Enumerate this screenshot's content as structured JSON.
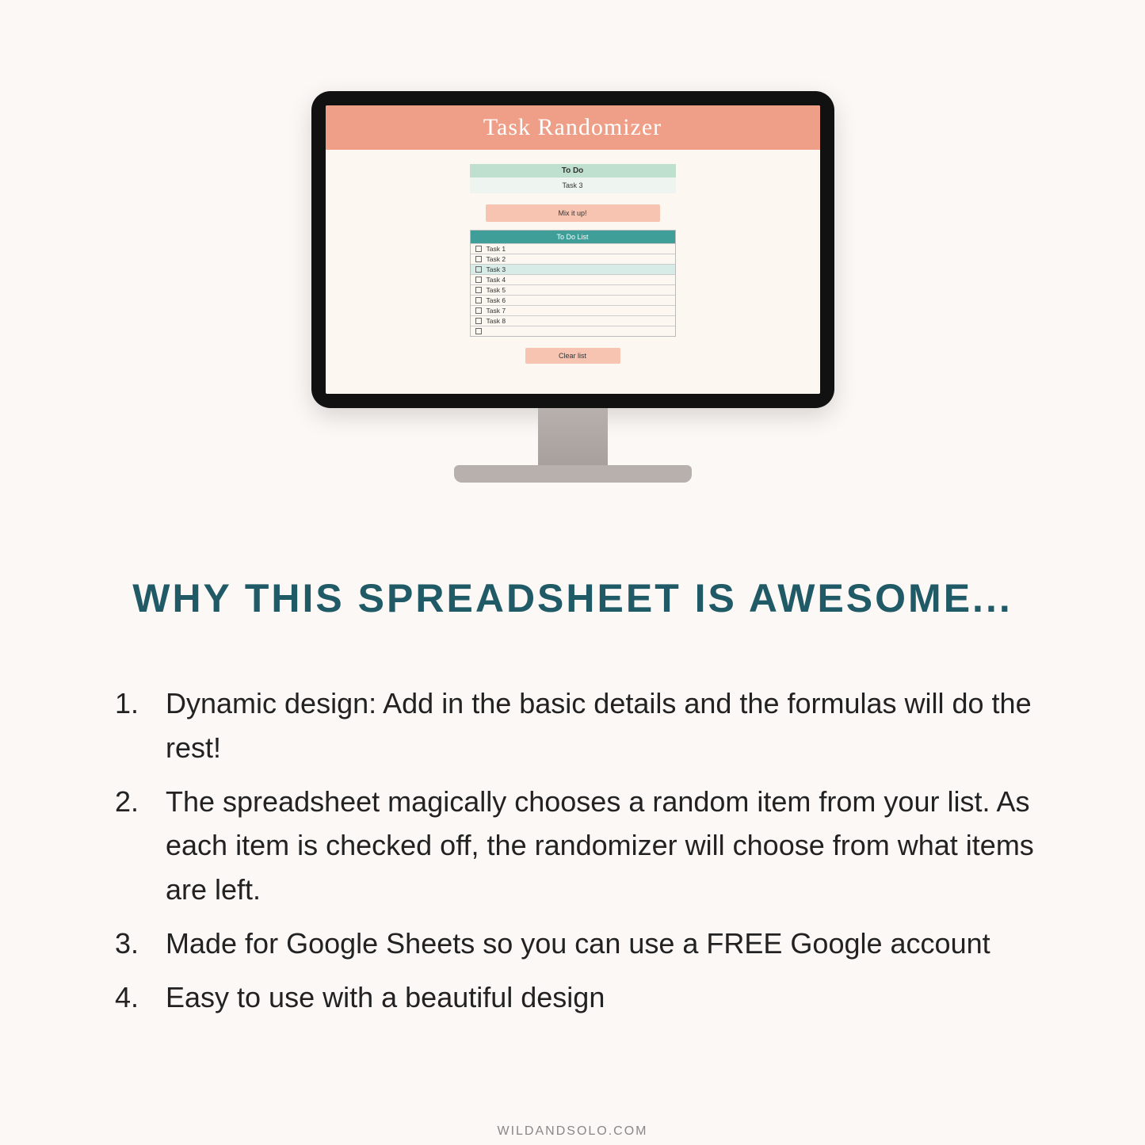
{
  "app": {
    "banner_title": "Task Randomizer",
    "todo_header": "To Do",
    "current_task": "Task 3",
    "mix_button": "Mix it up!",
    "list_header": "To Do List",
    "tasks": [
      "Task 1",
      "Task 2",
      "Task 3",
      "Task 4",
      "Task 5",
      "Task 6",
      "Task 7",
      "Task 8",
      ""
    ],
    "highlight_index": 2,
    "clear_button": "Clear list"
  },
  "headline": "WHY THIS SPREADSHEET IS AWESOME...",
  "features": [
    "Dynamic design: Add in the basic details and the formulas will do the rest!",
    "The spreadsheet magically chooses a random item from your list. As each item is checked off, the randomizer will choose from what items are left.",
    "Made for Google Sheets so you can use a FREE Google account",
    "Easy to use with a beautiful design"
  ],
  "footer": "WILDANDSOLO.COM"
}
